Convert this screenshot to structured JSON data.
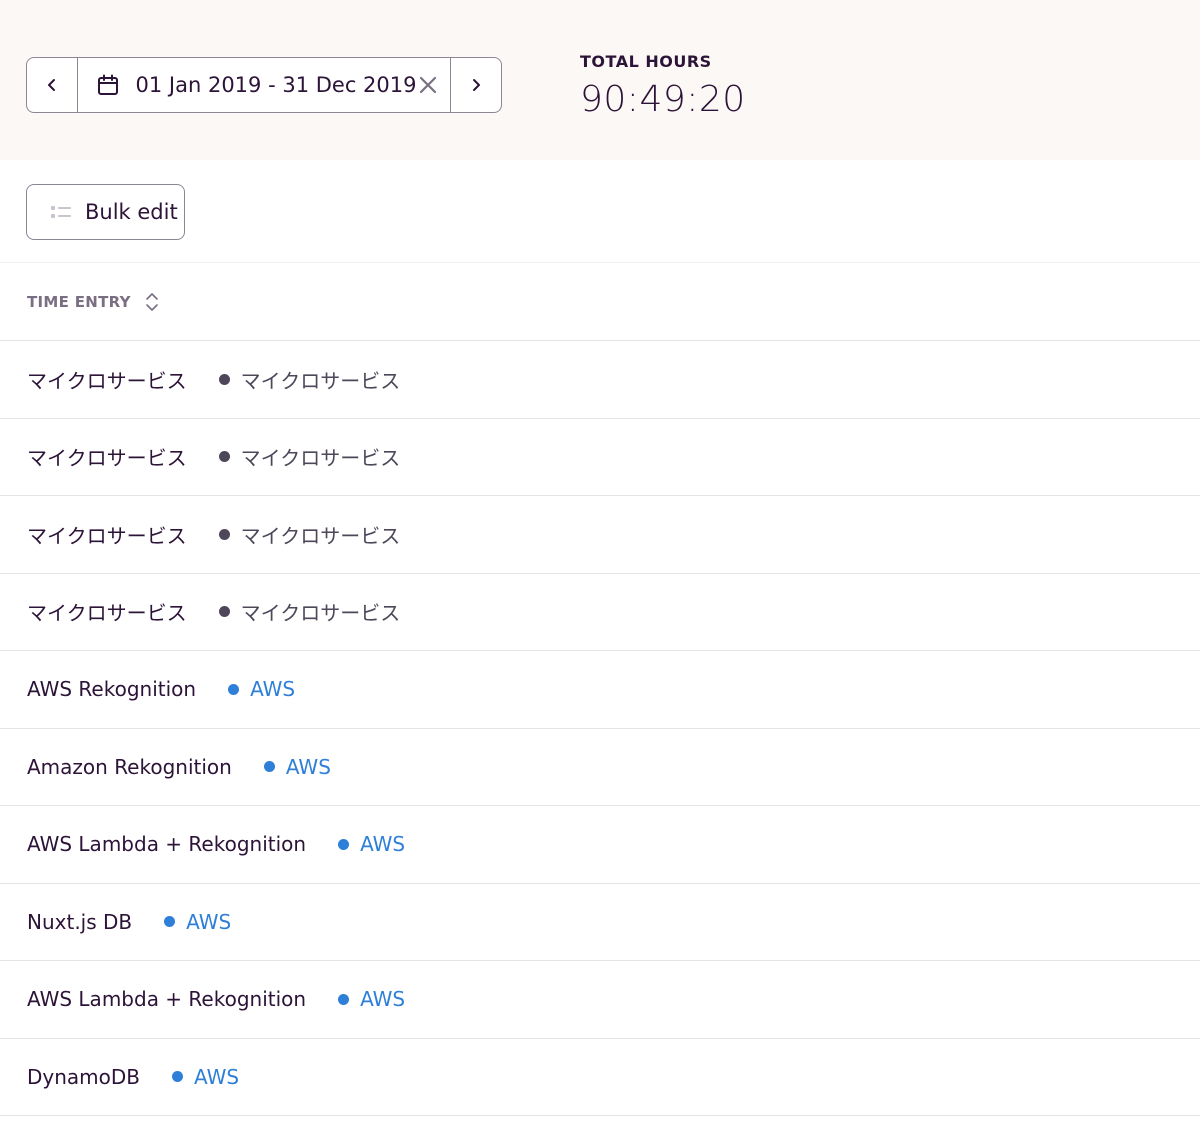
{
  "header": {
    "date_range": "01 Jan 2019 - 31 Dec 2019",
    "total_label": "TOTAL HOURS",
    "total_value": "90:49:20",
    "icons": {
      "prev": "chevron-left-icon",
      "calendar": "calendar-icon",
      "clear": "close-icon",
      "next": "chevron-right-icon"
    }
  },
  "toolbar": {
    "bulk_edit_label": "Bulk edit",
    "bulk_edit_icon": "list-icon"
  },
  "table": {
    "column_header": "TIME ENTRY",
    "sort_icon": "sort-icon",
    "rows": [
      {
        "description": "マイクロサービス",
        "project": "マイクロサービス",
        "color": "#4d4759"
      },
      {
        "description": "マイクロサービス",
        "project": "マイクロサービス",
        "color": "#4d4759"
      },
      {
        "description": "マイクロサービス",
        "project": "マイクロサービス",
        "color": "#4d4759"
      },
      {
        "description": "マイクロサービス",
        "project": "マイクロサービス",
        "color": "#4d4759"
      },
      {
        "description": "AWS Rekognition",
        "project": "AWS",
        "color": "#2e7fd8"
      },
      {
        "description": "Amazon Rekognition",
        "project": "AWS",
        "color": "#2e7fd8"
      },
      {
        "description": "AWS Lambda + Rekognition",
        "project": "AWS",
        "color": "#2e7fd8"
      },
      {
        "description": "Nuxt.js DB",
        "project": "AWS",
        "color": "#2e7fd8"
      },
      {
        "description": "AWS Lambda + Rekognition",
        "project": "AWS",
        "color": "#2e7fd8"
      },
      {
        "description": "DynamoDB",
        "project": "AWS",
        "color": "#2e7fd8"
      }
    ]
  },
  "colors": {
    "header_bg": "#fcf8f5",
    "text": "#2c1338",
    "muted": "#7a6f82",
    "border": "#8c8594",
    "aws_blue": "#2e7fd8",
    "dark_dot": "#4d4759"
  }
}
